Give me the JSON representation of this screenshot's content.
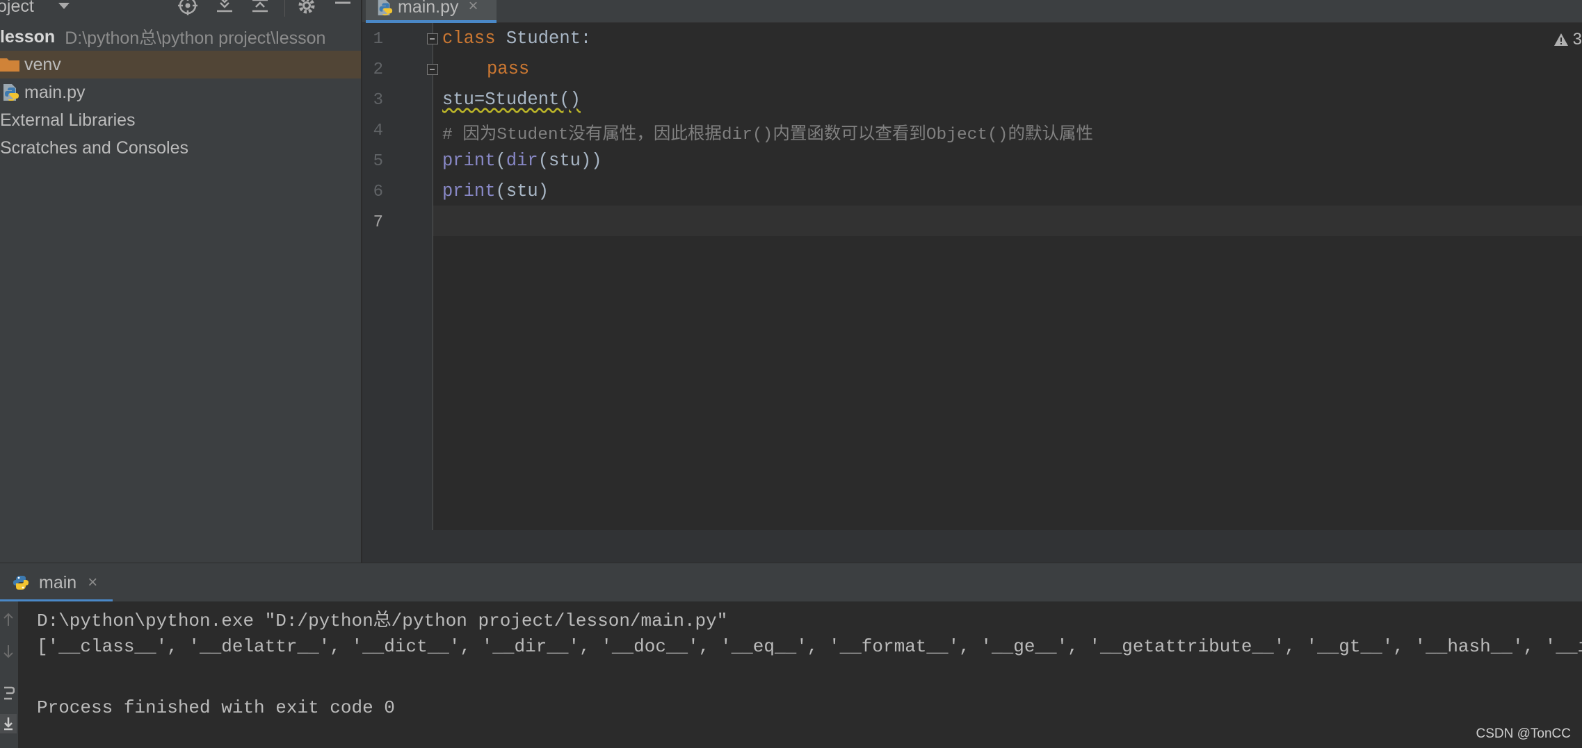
{
  "project_panel": {
    "title": "oject",
    "tree": {
      "root_name": "lesson",
      "root_path": "D:\\python总\\python project\\lesson",
      "items": [
        {
          "label": "venv"
        },
        {
          "label": "main.py"
        },
        {
          "label": "External Libraries"
        },
        {
          "label": "Scratches and Consoles"
        }
      ]
    }
  },
  "editor": {
    "tab_label": "main.py",
    "tab_close": "×",
    "warning_count": "3",
    "line_numbers": [
      "1",
      "2",
      "3",
      "4",
      "5",
      "6",
      "7"
    ],
    "lines": {
      "l1_kw": "class",
      "l1_rest": " Student:",
      "l2_kw": "pass",
      "l3": "stu=Student()",
      "l4_comment": "# 因为Student没有属性，因此根据dir()内置函数可以查看到Object()的默认属性",
      "l5_fn": "print",
      "l5_mid": "(",
      "l5_fn2": "dir",
      "l5_rest": "(stu))",
      "l6_fn": "print",
      "l6_rest": "(stu)"
    }
  },
  "run_panel": {
    "tab_label": "main",
    "tab_close": "×",
    "console": [
      "D:\\python\\python.exe \"D:/python总/python project/lesson/main.py\"",
      "['__class__', '__delattr__', '__dict__', '__dir__', '__doc__', '__eq__', '__format__', '__ge__', '__getattribute__', '__gt__', '__hash__', '__init__', '__init_subclass__', '__le__', '__lt__', '__module__', '__ne__', '__new__', '__reduce__', '__reduce_ex__', '__repr__', '__setattr__', '__sizeof__', '__str__', '__subclasshook__', '__weakref__']",
      "",
      "Process finished with exit code 0"
    ]
  },
  "watermark": "CSDN @TonCC"
}
